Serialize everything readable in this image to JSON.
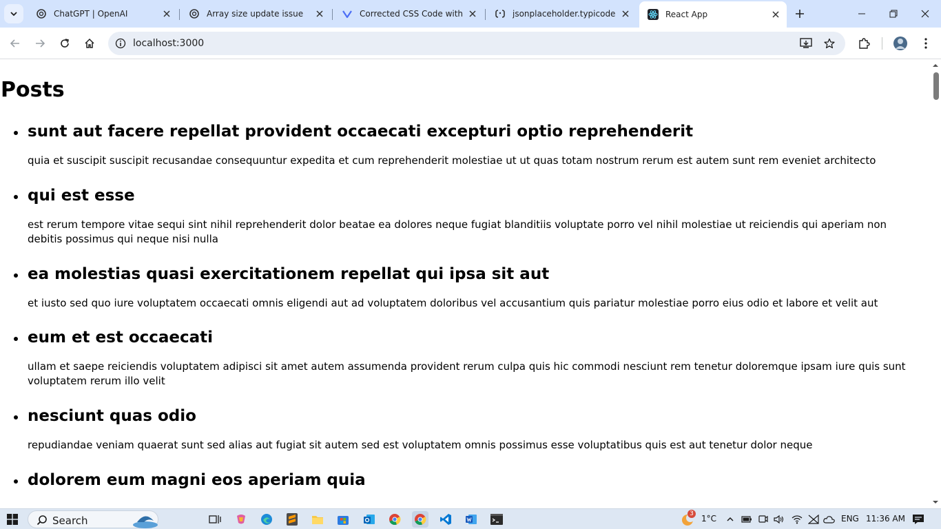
{
  "browser": {
    "tabs": [
      {
        "title": "ChatGPT | OpenAI",
        "favicon": "openai-icon",
        "active": false
      },
      {
        "title": "Array size update issue",
        "favicon": "openai-icon",
        "active": false
      },
      {
        "title": "Corrected CSS Code with Sy",
        "favicon": "copilot-icon",
        "active": false
      },
      {
        "title": "jsonplaceholder.typicode.co",
        "favicon": "typicode-icon",
        "active": false
      },
      {
        "title": "React App",
        "favicon": "react-icon",
        "active": true
      }
    ],
    "address": "localhost:3000",
    "accent_color": "#d3e3fd"
  },
  "page": {
    "heading": "Posts",
    "posts": [
      {
        "title": "sunt aut facere repellat provident occaecati excepturi optio reprehenderit",
        "body": "quia et suscipit suscipit recusandae consequuntur expedita et cum reprehenderit molestiae ut ut quas totam nostrum rerum est autem sunt rem eveniet architecto"
      },
      {
        "title": "qui est esse",
        "body": "est rerum tempore vitae sequi sint nihil reprehenderit dolor beatae ea dolores neque fugiat blanditiis voluptate porro vel nihil molestiae ut reiciendis qui aperiam non debitis possimus qui neque nisi nulla"
      },
      {
        "title": "ea molestias quasi exercitationem repellat qui ipsa sit aut",
        "body": "et iusto sed quo iure voluptatem occaecati omnis eligendi aut ad voluptatem doloribus vel accusantium quis pariatur molestiae porro eius odio et labore et velit aut"
      },
      {
        "title": "eum et est occaecati",
        "body": "ullam et saepe reiciendis voluptatem adipisci sit amet autem assumenda provident rerum culpa quis hic commodi nesciunt rem tenetur doloremque ipsam iure quis sunt voluptatem rerum illo velit"
      },
      {
        "title": "nesciunt quas odio",
        "body": "repudiandae veniam quaerat sunt sed alias aut fugiat sit autem sed est voluptatem omnis possimus esse voluptatibus quis est aut tenetur dolor neque"
      },
      {
        "title": "dolorem eum magni eos aperiam quia",
        "body": ""
      }
    ]
  },
  "taskbar": {
    "search_label": "Search",
    "weather_badge": "3",
    "temperature": "1°C",
    "language": "ENG",
    "time": "11:36 AM"
  }
}
